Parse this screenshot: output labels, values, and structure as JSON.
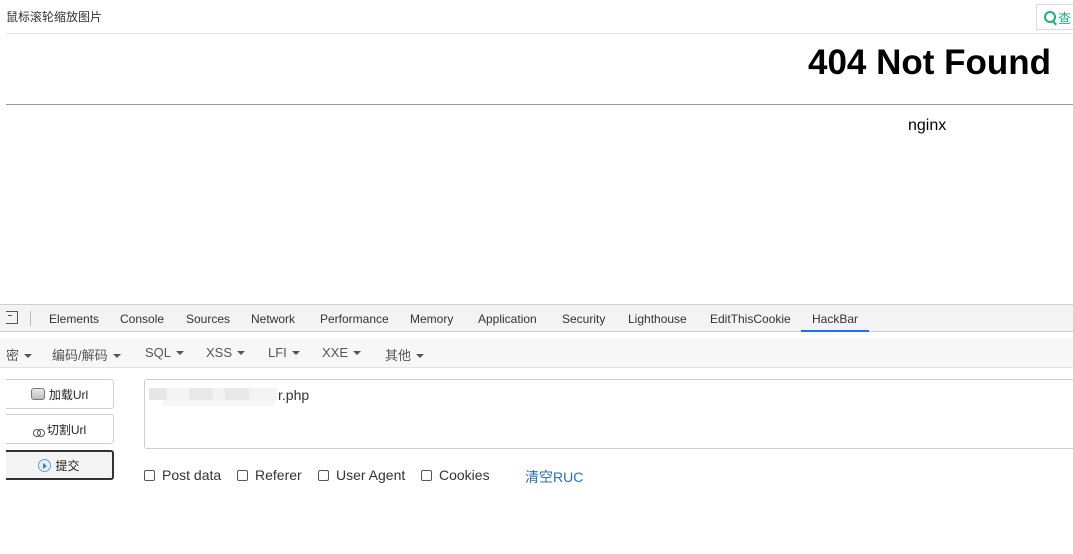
{
  "hint_bar": {
    "text": "鼠标滚轮缩放图片",
    "widget_text": "查"
  },
  "page": {
    "title": "404 Not Found",
    "server": "nginx"
  },
  "devtools": {
    "tabs": [
      "Elements",
      "Console",
      "Sources",
      "Network",
      "Performance",
      "Memory",
      "Application",
      "Security",
      "Lighthouse",
      "EditThisCookie",
      "HackBar"
    ],
    "active_tab": "HackBar"
  },
  "hackbar": {
    "menu": [
      "密",
      "编码/解码",
      "SQL",
      "XSS",
      "LFI",
      "XXE",
      "其他"
    ],
    "buttons": {
      "load": "加载Url",
      "split": "切割Url",
      "execute": "提交"
    },
    "url_value": "r.php",
    "options": {
      "post_data": "Post data",
      "referer": "Referer",
      "user_agent": "User Agent",
      "cookies": "Cookies"
    },
    "clear_link": "清空RUC"
  }
}
